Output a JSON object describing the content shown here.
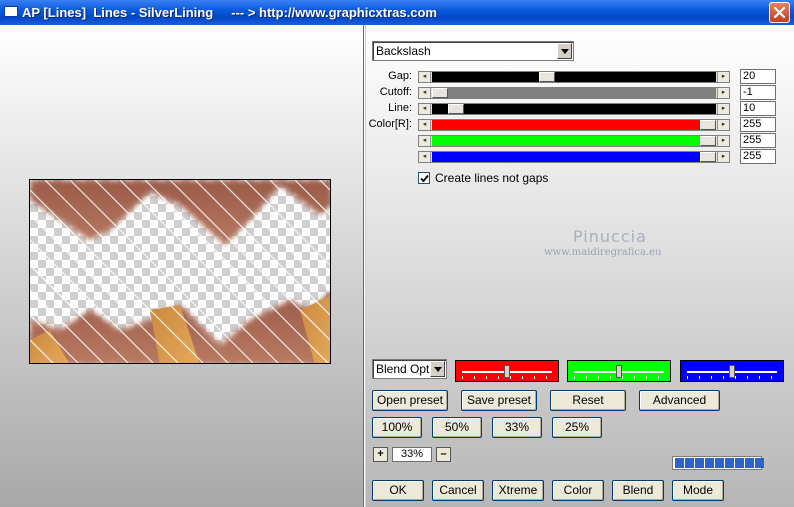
{
  "window": {
    "title": "AP [Lines]  Lines - SilverLining     --- > http://www.graphicxtras.com",
    "close_icon": "close-icon",
    "titlebar_color": "#0a5bdc",
    "close_color": "#c23f1c"
  },
  "preset_select": {
    "value": "Backslash"
  },
  "sliders": [
    {
      "label": "Gap:",
      "value": "20",
      "fill": "#000000",
      "position": 0.4
    },
    {
      "label": "Cutoff:",
      "value": "-1",
      "fill": "#808080",
      "position": 0.0
    },
    {
      "label": "Line:",
      "value": "10",
      "fill": "#000000",
      "position": 0.06
    },
    {
      "label": "Color[R]:",
      "value": "255",
      "fill": "#ff0000",
      "position": 1.0
    },
    {
      "label": "",
      "value": "255",
      "fill": "#00ff00",
      "position": 1.0
    },
    {
      "label": "",
      "value": "255",
      "fill": "#0000ff",
      "position": 1.0
    }
  ],
  "checkbox": {
    "label": "Create lines not gaps",
    "checked": true
  },
  "watermark": {
    "line1": "Pinuccia",
    "line2": "www.maidiregrafica.eu"
  },
  "blend_select": {
    "value": "Blend Optio"
  },
  "color_boxes": [
    {
      "color": "#ff0000",
      "position": 0.5
    },
    {
      "color": "#00ff00",
      "position": 0.5
    },
    {
      "color": "#0000ff",
      "position": 0.5
    }
  ],
  "buttons_row1": {
    "open_preset": "Open preset",
    "save_preset": "Save preset",
    "reset": "Reset",
    "advanced": "Advanced"
  },
  "zoom_buttons": {
    "z100": "100%",
    "z50": "50%",
    "z33": "33%",
    "z25": "25%"
  },
  "zoom": {
    "plus": "+",
    "value": "33%",
    "minus": "–"
  },
  "progress": {
    "segments": 9
  },
  "buttons_bottom": {
    "ok": "OK",
    "cancel": "Cancel",
    "xtreme": "Xtreme",
    "color": "Color",
    "blend": "Blend",
    "mode": "Mode"
  }
}
